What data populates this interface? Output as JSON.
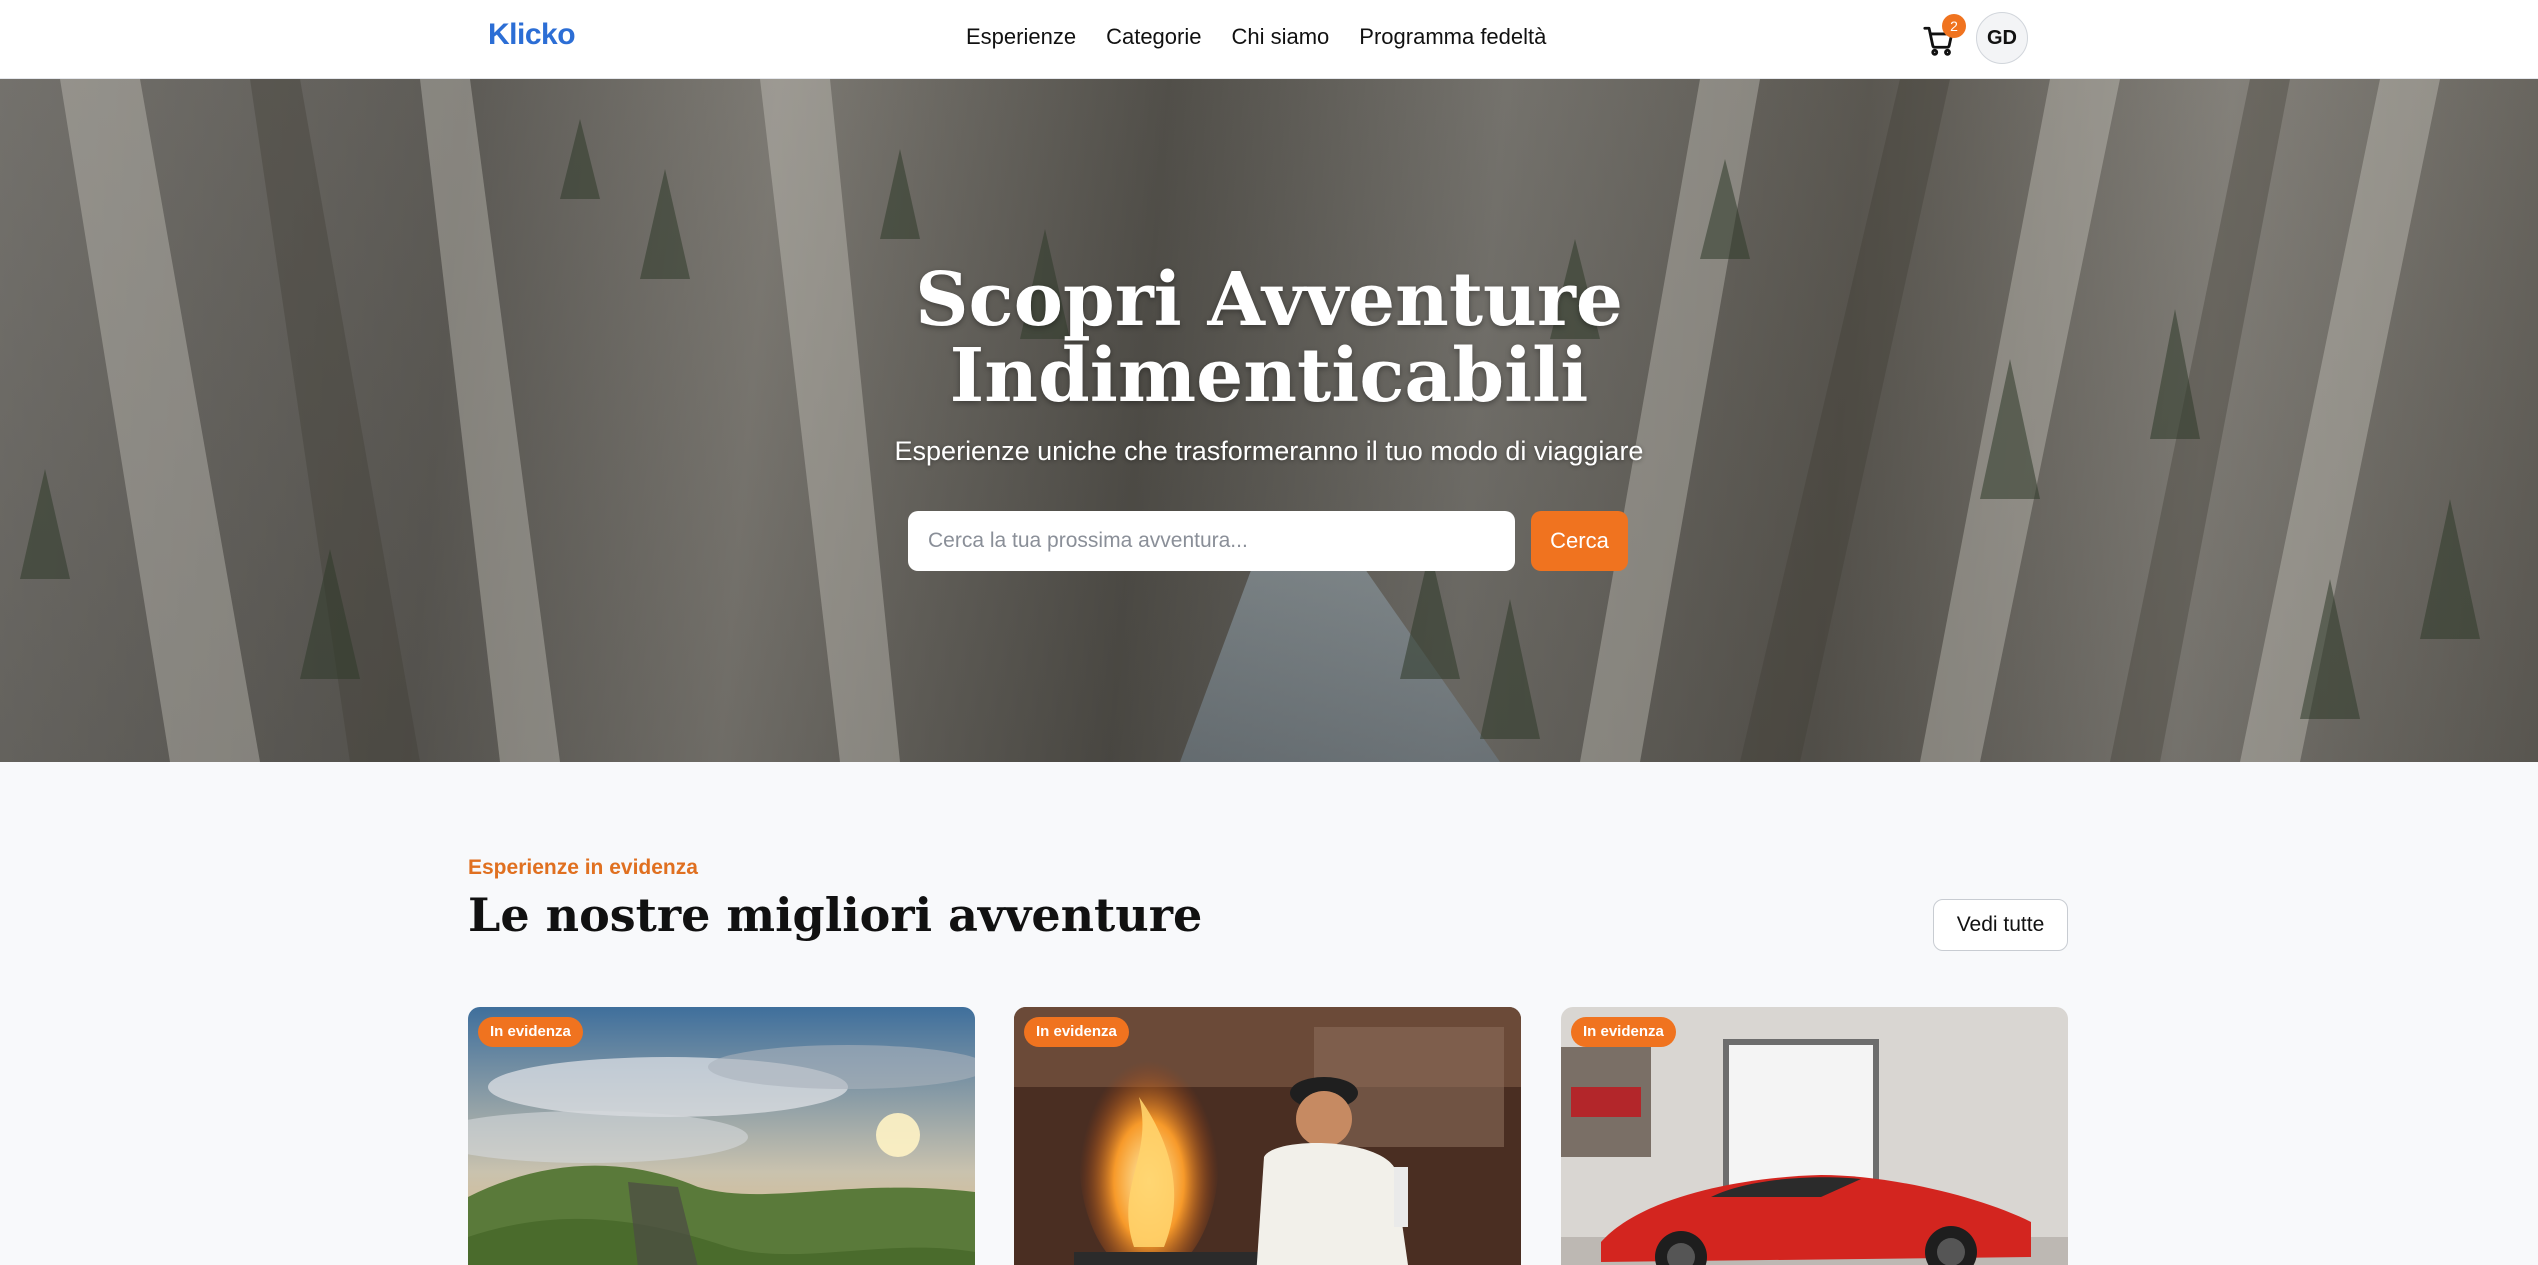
{
  "header": {
    "logo": "Klicko",
    "nav": [
      "Esperienze",
      "Categorie",
      "Chi siamo",
      "Programma fedeltà"
    ],
    "cart_count": "2",
    "avatar_initials": "GD"
  },
  "hero": {
    "title_line1": "Scopri Avventure",
    "title_line2": "Indimenticabili",
    "subtitle": "Esperienze uniche che trasformeranno il tuo modo di viaggiare",
    "search_placeholder": "Cerca la tua prossima avventura...",
    "search_button": "Cerca"
  },
  "featured": {
    "eyebrow": "Esperienze in evidenza",
    "title": "Le nostre migliori avventure",
    "see_all": "Vedi tutte",
    "cards": [
      {
        "badge": "In evidenza"
      },
      {
        "badge": "In evidenza"
      },
      {
        "badge": "In evidenza"
      }
    ]
  },
  "colors": {
    "brand": "#2c6ed5",
    "accent": "#f0731f"
  }
}
